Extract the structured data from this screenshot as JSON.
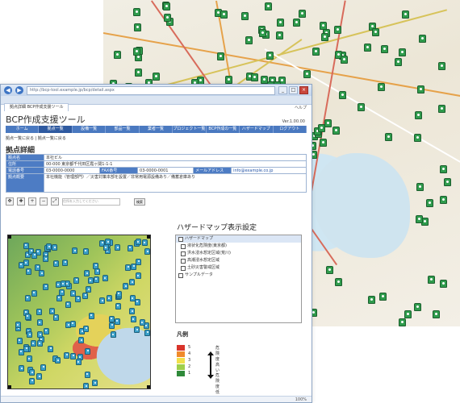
{
  "browser": {
    "address": "http://bcp-tool.example.jp/bcp/detail.aspx",
    "tab_label": "拠点詳細 BCP作成支援ツール",
    "window_controls": [
      "_",
      "□",
      "×"
    ]
  },
  "app": {
    "top_links": "ヘルプ",
    "title": "BCP作成支援ツール",
    "version": "Ver.1.00.00",
    "menu": [
      "ホーム",
      "拠点一覧",
      "設備一覧",
      "部品一覧",
      "業者一覧",
      "プロジェクト一覧",
      "BCP作成の一覧",
      "ハザードマップ",
      "ログアウト"
    ],
    "active_menu_index": 1,
    "subnav": "拠点一覧に戻る | 拠点一覧に戻る"
  },
  "detail": {
    "section_title": "拠点詳細",
    "rows": [
      {
        "label": "拠点名",
        "value": "本社ビル",
        "extra": ""
      },
      {
        "label": "住所",
        "value": "00-000 東京都千代田区霞ヶ関1-1-1",
        "extra": ""
      },
      {
        "label": "電話番号",
        "value": "03-0000-0000",
        "label2": "FAX番号",
        "value2": "03-0000-0001",
        "label3": "メールアドレス",
        "value3": "info@example.co.jp"
      },
      {
        "label": "拠点概要",
        "value": "本社機能（管理部門）／災害対策本部を設置／非常用電源設備あり／備蓄倉庫あり",
        "extra": ""
      }
    ]
  },
  "toolbar": {
    "search_placeholder": "住所を入力してください",
    "search_button": "検索"
  },
  "hazard": {
    "title": "ハザードマップ表示設定",
    "layers": [
      {
        "label": "ハザードマップ",
        "indent": false,
        "selected": true
      },
      {
        "label": "液状化危険度(東京都)",
        "indent": true,
        "selected": false
      },
      {
        "label": "洪水浸水想定区域(荒川)",
        "indent": true,
        "selected": false
      },
      {
        "label": "高潮浸水想定区域",
        "indent": true,
        "selected": false
      },
      {
        "label": "土砂災害警戒区域",
        "indent": true,
        "selected": false
      },
      {
        "label": "サンプルデータ",
        "indent": false,
        "selected": false
      }
    ]
  },
  "legend": {
    "title": "凡例",
    "items": [
      {
        "label": "5",
        "color": "#d9342b"
      },
      {
        "label": "4",
        "color": "#f08a2a"
      },
      {
        "label": "3",
        "color": "#f1e04a"
      },
      {
        "label": "2",
        "color": "#9fcf4a"
      },
      {
        "label": "1",
        "color": "#2f8a3a"
      }
    ],
    "high_text": "危険度 高い",
    "low_text": "危険度 低い"
  },
  "status": {
    "zoom": "100%"
  },
  "colors": {
    "menu_bg": "#4a79c0",
    "marker": "#2f9b4c"
  }
}
